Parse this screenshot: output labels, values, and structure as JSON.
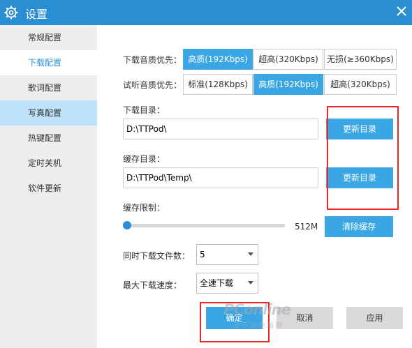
{
  "window": {
    "title": "设置",
    "accent_color": "#2a8fd2",
    "gear_icon": "gear-icon",
    "close_icon": "close-icon"
  },
  "sidebar": {
    "items": [
      {
        "label": "常规配置"
      },
      {
        "label": "下载配置"
      },
      {
        "label": "歌词配置"
      },
      {
        "label": "写真配置"
      },
      {
        "label": "热键配置"
      },
      {
        "label": "定时关机"
      },
      {
        "label": "软件更新"
      }
    ],
    "active_index": 1,
    "hover_index": 3
  },
  "download_quality": {
    "label": "下载音质优先：",
    "options": [
      "高质(192Kbps)",
      "超高(320Kbps)",
      "无损(≥360Kbps)"
    ],
    "selected_index": 0
  },
  "listen_quality": {
    "label": "试听音质优先：",
    "options": [
      "标准(128Kbps)",
      "高质(192Kbps)",
      "超高(320Kbps)"
    ],
    "selected_index": 1
  },
  "download_dir": {
    "label": "下载目录：",
    "value": "D:\\TTPod\\",
    "button": "更新目录"
  },
  "cache_dir": {
    "label": "缓存目录：",
    "value": "D:\\TTPod\\Temp\\",
    "button": "更新目录"
  },
  "cache_limit": {
    "label": "缓存限制：",
    "value_text": "512M",
    "slider_fraction": 0.0,
    "clear_button": "清除缓存"
  },
  "concurrent_downloads": {
    "label": "同时下载文件数：",
    "value": "5"
  },
  "max_speed": {
    "label": "最大下载速度：",
    "value": "全速下载"
  },
  "footer": {
    "ok": "确定",
    "cancel": "取消",
    "apply": "应用"
  },
  "watermark": {
    "brand": "PConline",
    "sub": "太平洋电脑网"
  },
  "highlight_color": "#e8262b"
}
